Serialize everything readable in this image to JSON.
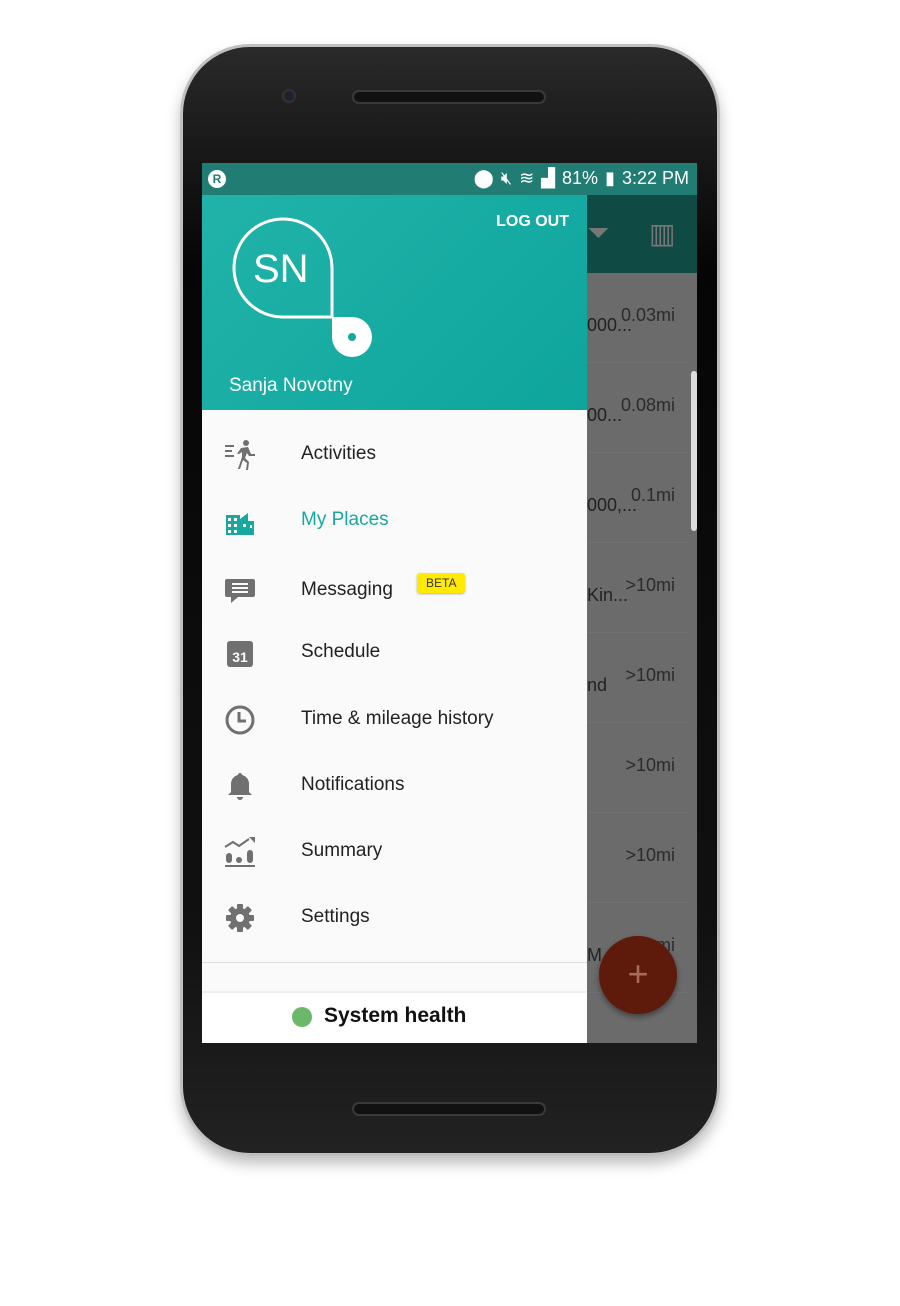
{
  "status_bar": {
    "battery": "81%",
    "time": "3:22 PM",
    "app_icon": "R"
  },
  "header": {
    "initials": "SN",
    "user_name": "Sanja Novotny",
    "logout_label": "LOG OUT"
  },
  "menu": [
    {
      "label": "Activities",
      "icon": "running-person-icon"
    },
    {
      "label": "My Places",
      "icon": "buildings-icon",
      "active": true
    },
    {
      "label": "Messaging",
      "icon": "message-icon",
      "badge": "BETA"
    },
    {
      "label": "Schedule",
      "icon": "calendar-icon",
      "icon_text": "31"
    },
    {
      "label": "Time & mileage history",
      "icon": "clock-icon"
    },
    {
      "label": "Notifications",
      "icon": "bell-icon"
    },
    {
      "label": "Summary",
      "icon": "chart-icon"
    },
    {
      "label": "Settings",
      "icon": "gear-icon"
    }
  ],
  "system_health": {
    "label": "System health",
    "status_color": "#6bb86a"
  },
  "background_list": [
    {
      "name": "000...",
      "distance": "0.03mi"
    },
    {
      "name": "00...",
      "distance": "0.08mi"
    },
    {
      "name": "000,...",
      "distance": "0.1mi"
    },
    {
      "name": "Kin...",
      "distance": ">10mi"
    },
    {
      "name": "nd",
      "distance": ">10mi"
    },
    {
      "name": "",
      "distance": ">10mi"
    },
    {
      "name": "",
      "distance": ">10mi"
    },
    {
      "name": "M",
      "distance": "mi"
    }
  ],
  "fab": {
    "label": "+"
  },
  "colors": {
    "accent": "#17a89f",
    "header": "#1aafa5",
    "beta": "#ffea00"
  }
}
